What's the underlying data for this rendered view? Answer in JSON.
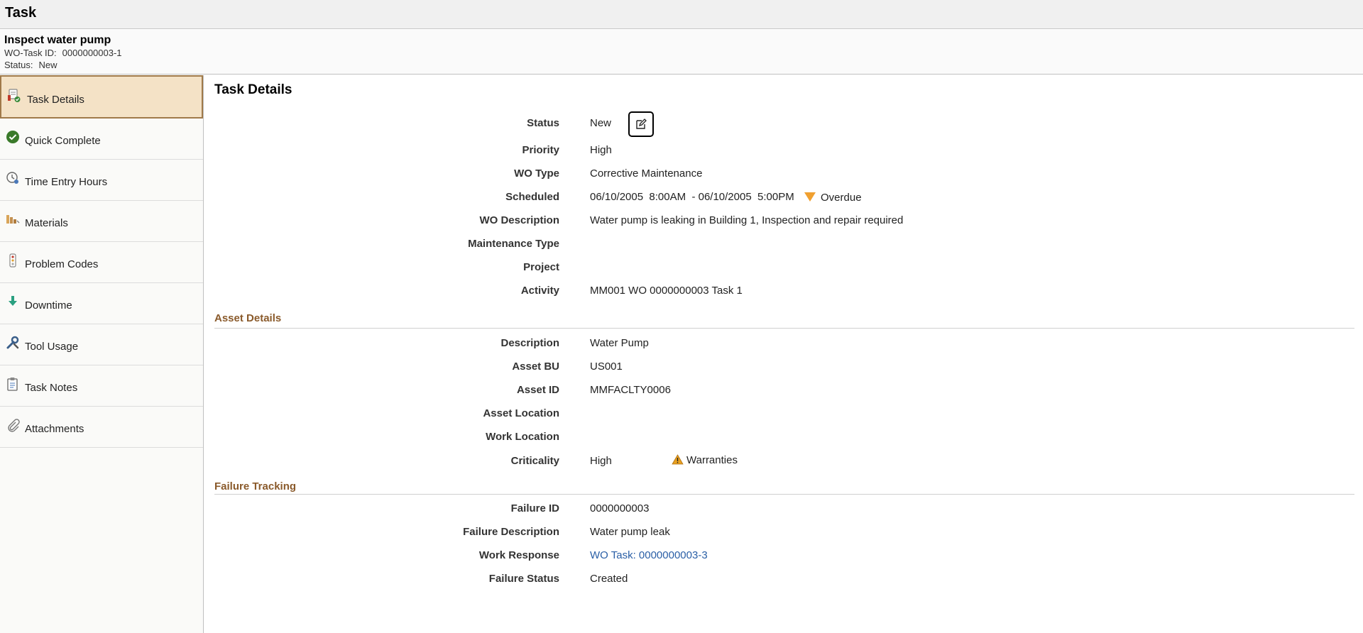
{
  "window": {
    "title": "Task"
  },
  "header": {
    "task_name": "Inspect water pump",
    "wo_task_id_label": "WO-Task ID:",
    "wo_task_id": "0000000003-1",
    "status_label": "Status:",
    "status": "New"
  },
  "sidebar": {
    "items": [
      {
        "label": "Task Details",
        "icon": "task-details-icon",
        "active": true
      },
      {
        "label": "Quick Complete",
        "icon": "check-circle-icon"
      },
      {
        "label": "Time Entry Hours",
        "icon": "time-entry-icon"
      },
      {
        "label": "Materials",
        "icon": "materials-icon"
      },
      {
        "label": "Problem Codes",
        "icon": "problem-codes-icon"
      },
      {
        "label": "Downtime",
        "icon": "down-arrow-icon"
      },
      {
        "label": "Tool Usage",
        "icon": "tool-icon"
      },
      {
        "label": "Task Notes",
        "icon": "clipboard-icon"
      },
      {
        "label": "Attachments",
        "icon": "paperclip-icon"
      }
    ]
  },
  "main": {
    "title": "Task Details",
    "task_fields": [
      {
        "label": "Status",
        "value": "New"
      },
      {
        "label": "Priority",
        "value": "High"
      },
      {
        "label": "WO Type",
        "value": "Corrective Maintenance"
      },
      {
        "label": "Scheduled",
        "value": "06/10/2005  8:00AM  - 06/10/2005  5:00PM"
      },
      {
        "label": "WO Description",
        "value": "Water pump is leaking in Building 1, Inspection and repair required"
      },
      {
        "label": "Maintenance Type",
        "value": ""
      },
      {
        "label": "Project",
        "value": ""
      },
      {
        "label": "Activity",
        "value": "MM001 WO 0000000003 Task 1"
      }
    ],
    "overdue_label": "Overdue",
    "asset_section": {
      "title": "Asset Details",
      "fields": [
        {
          "label": "Description",
          "value": "Water Pump"
        },
        {
          "label": "Asset BU",
          "value": "US001"
        },
        {
          "label": "Asset ID",
          "value": "MMFACLTY0006"
        },
        {
          "label": "Asset Location",
          "value": ""
        },
        {
          "label": "Work Location",
          "value": ""
        },
        {
          "label": "Criticality",
          "value": "High"
        }
      ],
      "warranties_label": "Warranties"
    },
    "failure_section": {
      "title": "Failure Tracking",
      "fields": [
        {
          "label": "Failure ID",
          "value": "0000000003"
        },
        {
          "label": "Failure Description",
          "value": "Water pump leak"
        },
        {
          "label": "Work Response",
          "value": "WO Task: 0000000003-3",
          "link": true
        },
        {
          "label": "Failure Status",
          "value": "Created"
        }
      ]
    }
  },
  "colors": {
    "accent_section": "#8a5a2b",
    "active_nav_bg": "#f4e2c6",
    "link": "#2a5fa6",
    "overdue": "#f0a030"
  }
}
